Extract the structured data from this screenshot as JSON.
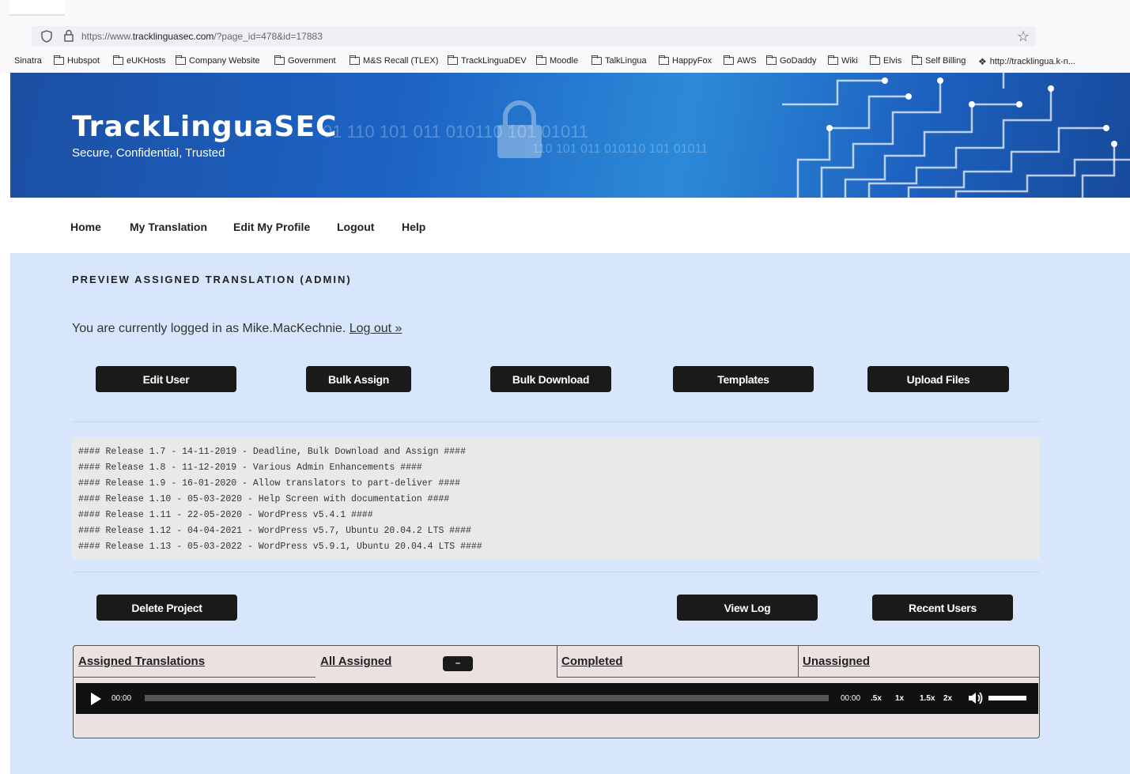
{
  "browser": {
    "url_prefix": "https://www.",
    "url_domain": "tracklinguasec.com",
    "url_path": "/?page_id=478&id=17883",
    "bookmarks": [
      {
        "label": "Sinatra",
        "icon": "folder-icon"
      },
      {
        "label": "Hubspot",
        "icon": "folder-icon"
      },
      {
        "label": "eUKHosts",
        "icon": "folder-icon"
      },
      {
        "label": "Company Website",
        "icon": "folder-icon"
      },
      {
        "label": "Government",
        "icon": "folder-icon"
      },
      {
        "label": "M&S Recall (TLEX)",
        "icon": "folder-icon"
      },
      {
        "label": "TrackLinguaDEV",
        "icon": "folder-icon"
      },
      {
        "label": "Moodle",
        "icon": "folder-icon"
      },
      {
        "label": "TalkLingua",
        "icon": "folder-icon"
      },
      {
        "label": "HappyFox",
        "icon": "folder-icon"
      },
      {
        "label": "AWS",
        "icon": "folder-icon"
      },
      {
        "label": "GoDaddy",
        "icon": "folder-icon"
      },
      {
        "label": "Wiki",
        "icon": "folder-icon"
      },
      {
        "label": "Elvis",
        "icon": "folder-icon"
      },
      {
        "label": "Self Billing",
        "icon": "folder-icon"
      },
      {
        "label": "http://tracklingua.k-n...",
        "icon": "site-icon"
      }
    ]
  },
  "header": {
    "title": "TrackLinguaSEC",
    "tagline": "Secure, Confidential, Trusted",
    "binary_text": [
      "01 110 101 011 010110 101 01011",
      "110 101 011 010110 101 01011"
    ]
  },
  "nav": {
    "items": [
      "Home",
      "My Translation",
      "Edit My Profile",
      "Logout",
      "Help"
    ]
  },
  "main": {
    "heading": "PREVIEW ASSIGNED TRANSLATION (ADMIN)",
    "login_prefix": "You are currently logged in as Mike.MacKechnie.",
    "logout_link": "Log out »",
    "top_buttons": [
      "Edit User",
      "Bulk Assign",
      "Bulk Download",
      "Templates",
      "Upload Files"
    ],
    "releases": [
      "#### Release 1.7 - 14-11-2019 - Deadline, Bulk Download and Assign ####",
      "#### Release 1.8 - 11-12-2019 - Various Admin Enhancements ####",
      "#### Release 1.9 - 16-01-2020 - Allow translators to part-deliver ####",
      "#### Release 1.10 - 05-03-2020 - Help Screen with documentation ####",
      "#### Release 1.11 - 22-05-2020 - WordPress v5.4.1 ####",
      "#### Release 1.12 - 04-04-2021 - WordPress v5.7, Ubuntu 20.04.2 LTS ####",
      "#### Release 1.13 - 05-03-2022 - WordPress v5.9.1, Ubuntu 20.04.4 LTS ####"
    ],
    "bottom_buttons": {
      "delete": "Delete Project",
      "view_log": "View Log",
      "recent_users": "Recent Users"
    },
    "tabs": [
      "Assigned Translations",
      "All Assigned",
      "Completed",
      "Unassigned"
    ],
    "mini_button": "–",
    "player": {
      "current_time": "00:00",
      "duration": "00:00",
      "rates": [
        ".5x",
        "1x",
        "1.5x",
        "2x"
      ],
      "progress": 0,
      "volume": 1.0
    }
  }
}
